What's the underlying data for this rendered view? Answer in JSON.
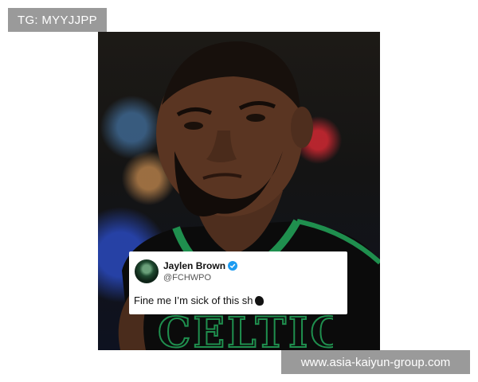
{
  "badge": {
    "text": "TG: MYYJJPP"
  },
  "photo": {
    "subject": "basketball player portrait",
    "jersey_text": "CELTICS",
    "colors": {
      "jersey": "#0b0b0b",
      "trim": "#1f8f4e",
      "skin": "#5a3522"
    }
  },
  "tweet": {
    "name": "Jaylen Brown",
    "handle": "@FCHWPO",
    "text": "Fine me I’m sick of this sh",
    "verified": true,
    "icons": {
      "verified": "verified-badge-icon",
      "emoji": "censored-emoji-icon"
    }
  },
  "watermark": {
    "text": "www.asia-kaiyun-group.com"
  }
}
